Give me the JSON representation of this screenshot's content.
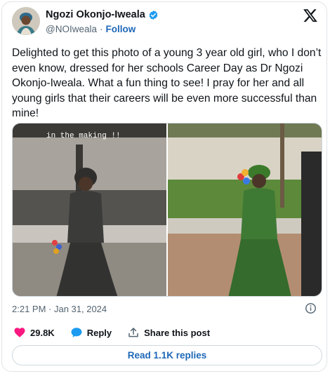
{
  "author": {
    "name": "Ngozi Okonjo-Iweala",
    "handle": "@NOIweala",
    "follow_label": "Follow"
  },
  "tweet": {
    "text": "Delighted to get this photo of a young 3 year old girl, who I don’t even know, dressed for her schools Career Day as Dr Ngozi Okonjo-Iweala. What a fun thing to see! I pray for her and all young girls that their careers will be even more successful than mine!",
    "photo_caption": "in the making !!"
  },
  "meta": {
    "timestamp": "2:21 PM · Jan 31, 2024"
  },
  "actions": {
    "likes": "29.8K",
    "reply_label": "Reply",
    "share_label": "Share this post",
    "read_replies_label": "Read 1.1K replies"
  },
  "colors": {
    "accent": "#1d67b8",
    "like": "#f91880",
    "muted": "#536471"
  },
  "icons": [
    "verified-badge-icon",
    "x-logo-icon",
    "info-icon",
    "heart-icon",
    "reply-bubble-icon",
    "share-upload-icon"
  ]
}
